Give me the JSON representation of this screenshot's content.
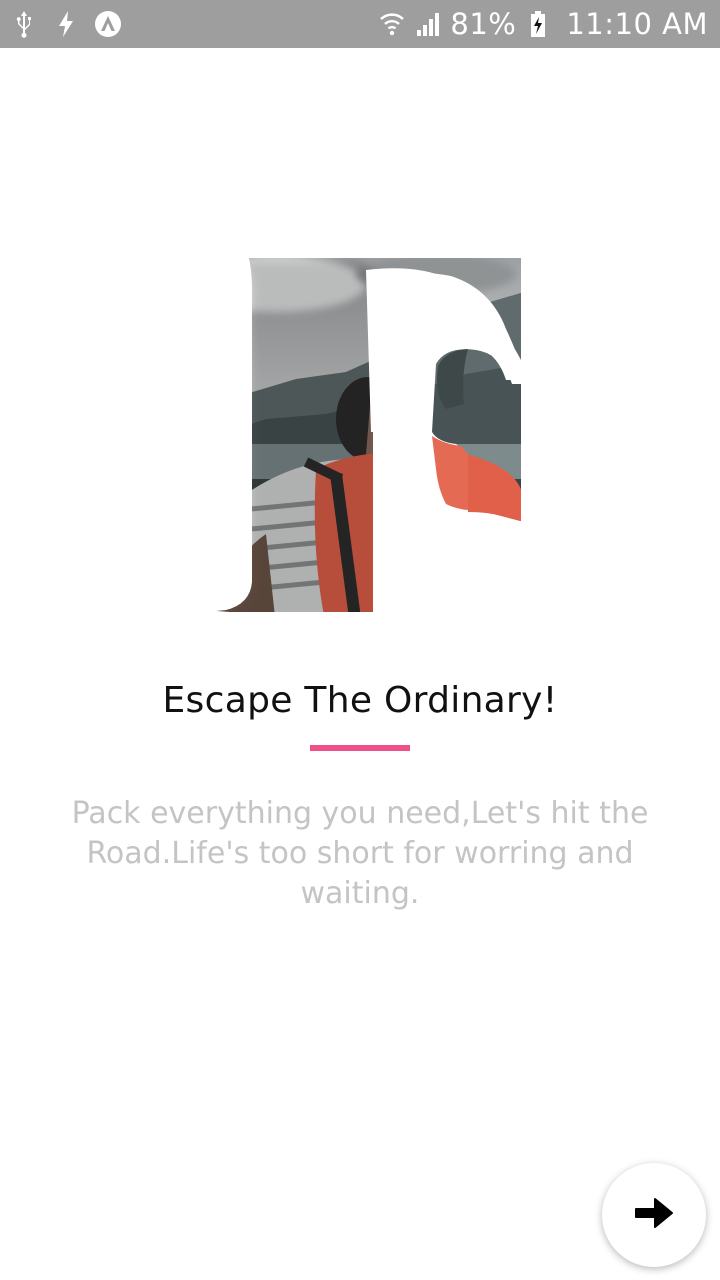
{
  "status_bar": {
    "battery_percent": "81%",
    "time": "11:10 AM",
    "left_icons": [
      "usb-icon",
      "flash-icon",
      "app-badge-icon"
    ],
    "right_icons": [
      "wifi-icon",
      "signal-icon",
      "battery-charging-icon"
    ],
    "background": "#9e9e9e"
  },
  "onboarding": {
    "hero_image": "letter-e-travel-photo",
    "title": "Escape The Ordinary!",
    "accent_color": "#f0508a",
    "description": "Pack everything you need,Let's hit the Road.Life's too short for worring and waiting.",
    "next_button_icon": "arrow-right-icon"
  }
}
